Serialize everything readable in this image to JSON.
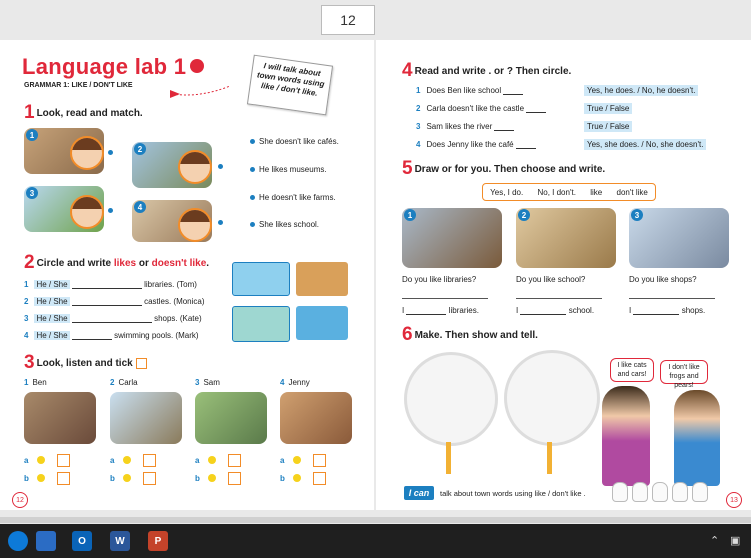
{
  "viewer": {
    "page_number": "12"
  },
  "left": {
    "title": "Language lab 1",
    "subtitle": "GRAMMAR 1: LIKE / DON'T LIKE",
    "note": [
      "I will talk about",
      "town words using",
      "like / don't like."
    ],
    "s1": {
      "num": "1",
      "title": "Look, read and match.",
      "sentences": [
        "She doesn't like cafés.",
        "He likes museums.",
        "He doesn't like farms.",
        "She likes school."
      ],
      "photo_nums": [
        "1",
        "2",
        "3",
        "4"
      ]
    },
    "s2": {
      "num": "2",
      "title_a": "Circle and write ",
      "title_likes": "likes",
      "title_or": " or ",
      "title_dl": "doesn't like",
      "title_dot": ".",
      "rows": [
        {
          "n": "1",
          "opt": "He / She",
          "end": "libraries. (Tom)"
        },
        {
          "n": "2",
          "opt": "He / She",
          "end": "castles. (Monica)"
        },
        {
          "n": "3",
          "opt": "He / She",
          "end": "shops. (Kate)"
        },
        {
          "n": "4",
          "opt": "He / She",
          "end": "swimming pools. (Mark)"
        }
      ]
    },
    "s3": {
      "num": "3",
      "title": "Look, listen and tick",
      "names": [
        {
          "n": "1",
          "name": "Ben"
        },
        {
          "n": "2",
          "name": "Carla"
        },
        {
          "n": "3",
          "name": "Sam"
        },
        {
          "n": "4",
          "name": "Jenny"
        }
      ],
      "a": "a",
      "b": "b"
    },
    "footer_page": "12"
  },
  "right": {
    "s4": {
      "num": "4",
      "title": "Read and write . or ? Then circle.",
      "rows": [
        {
          "n": "1",
          "q": "Does Ben like school",
          "ans": "Yes, he does.  /  No, he doesn't."
        },
        {
          "n": "2",
          "q": "Carla doesn't like the castle",
          "ans": "True  /  False"
        },
        {
          "n": "3",
          "q": "Sam likes the river",
          "ans": "True  /  False"
        },
        {
          "n": "4",
          "q": "Does Jenny like the café",
          "ans": "Yes, she does.  /  No, she doesn't."
        }
      ]
    },
    "s5": {
      "num": "5",
      "title": "Draw  or  for you. Then choose and write.",
      "words": [
        "Yes, I do.",
        "No, I don't.",
        "like",
        "don't like"
      ],
      "questions": [
        "Do you like libraries?",
        "Do you like school?",
        "Do you like shops?"
      ],
      "i": "I",
      "ends": [
        "libraries.",
        "school.",
        "shops."
      ],
      "photo_nums": [
        "1",
        "2",
        "3"
      ]
    },
    "s6": {
      "num": "6",
      "title": "Make. Then show and tell.",
      "bubble_girl": "I like cats and cars!",
      "bubble_boy": "I don't like frogs and pears!"
    },
    "ican": "I can",
    "ican_text": "talk about town words using like / don't like .",
    "footer_page": "13"
  },
  "colors": {
    "accent": "#e0283a",
    "blue": "#1c7fc0",
    "orange": "#f28c28"
  },
  "taskbar": {
    "icons": [
      "edge-icon",
      "pen-app-icon",
      "outlook-icon",
      "word-icon",
      "powerpoint-icon"
    ]
  }
}
